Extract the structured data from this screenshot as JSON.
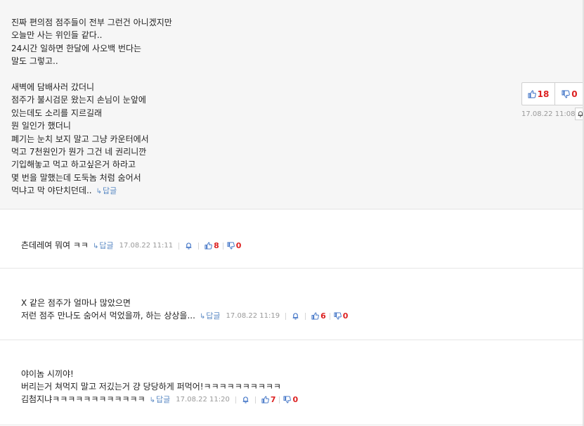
{
  "best_comment": {
    "text": "진짜 편의점 점주들이 전부 그런건 아니겠지만\n오늘만 사는 위인들 같다..\n24시간 일하면 한달에 사오백 번다는\n말도 그렇고..\n\n새벽에 담배사러 갔더니\n점주가 불시검문 왔는지 손님이 눈앞에\n있는데도 소리를 지르길래\n뭔 일인가 했더니\n폐기는 눈치 보지 말고 그냥 카운터에서\n먹고 7천원인가 뭔가 그건 네 권리니깐\n기입해놓고 먹고 하고싶은거 하라고\n몇 번을 말했는데 도둑놈 처럼 숨어서\n먹냐고 막 야단치던데..",
    "reply_label": "답글",
    "up": "18",
    "down": "0",
    "date": "17.08.22 11:08"
  },
  "comments": [
    {
      "text": "츤데레여 뭐여 ㅋㅋ",
      "reply_label": "답글",
      "date": "17.08.22 11:11",
      "up": "8",
      "down": "0"
    },
    {
      "text": "X 같은 점주가 얼마나 많았으면\n저런 점주 만나도 숨어서 먹었을까, 하는 상상을...",
      "reply_label": "답글",
      "date": "17.08.22 11:19",
      "up": "6",
      "down": "0"
    },
    {
      "text": "야이놈 시끼야!\n버리는거 쳐먹지 말고 저깄는거 걍 당당하게 퍼먹어!ㅋㅋㅋㅋㅋㅋㅋㅋㅋㅋ\n김첨지냐ㅋㅋㅋㅋㅋㅋㅋㅋㅋㅋㅋㅋ",
      "reply_label": "답글",
      "date": "17.08.22 11:20",
      "up": "7",
      "down": "0"
    }
  ],
  "colors": {
    "vote_count": "#dd2222",
    "thumb_icon": "#3a6fc4",
    "reply_link": "#5b8ac4",
    "meta_text": "#999999"
  }
}
